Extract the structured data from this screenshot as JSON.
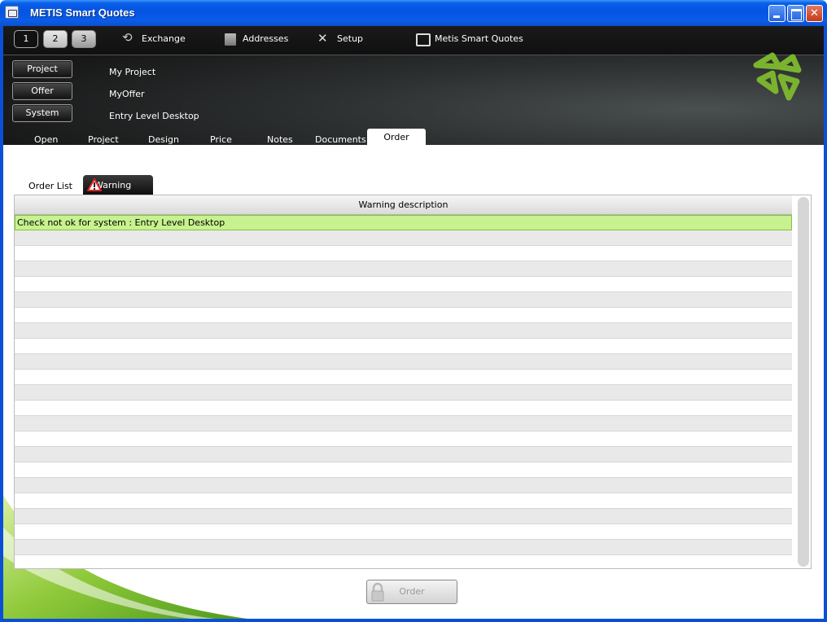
{
  "window": {
    "title": "METIS Smart Quotes"
  },
  "toolbar": {
    "steps": [
      "1",
      "2",
      "3"
    ],
    "items": [
      {
        "label": "Exchange",
        "icon": "exchange-icon"
      },
      {
        "label": "Addresses",
        "icon": "addresses-icon"
      },
      {
        "label": "Setup",
        "icon": "setup-icon"
      },
      {
        "label": "Metis Smart Quotes",
        "icon": "app-window-icon"
      }
    ]
  },
  "context": {
    "project_label": "Project",
    "project_value": "My Project",
    "offer_label": "Offer",
    "offer_value": "MyOffer",
    "system_label": "System",
    "system_value": "Entry Level Desktop"
  },
  "nav_tabs": [
    "Open",
    "Project",
    "Design",
    "Price",
    "Notes",
    "Documents",
    "Order"
  ],
  "active_nav_tab": "Order",
  "subtabs": {
    "order_list": "Order List",
    "warning": "Warning",
    "active": "Warning"
  },
  "warnings_table": {
    "header": "Warning description",
    "rows": [
      "Check not ok for system : Entry Level Desktop"
    ]
  },
  "order_button": {
    "label": "Order",
    "enabled": false
  },
  "colors": {
    "selected_row": "#c7f28f",
    "header_bg": "#151515",
    "accent_green": "#7ab32e"
  }
}
